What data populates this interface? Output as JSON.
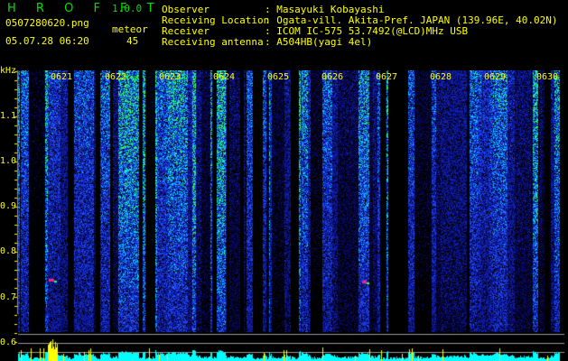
{
  "app": {
    "name": "H R O F F T",
    "version": "1.0.0"
  },
  "file": {
    "name": "0507280620.png",
    "datetime": "05.07.28 06:20"
  },
  "meteor": {
    "label": "meteor",
    "count": "45"
  },
  "station": {
    "observer_label": "Observer",
    "observer": ": Masayuki Kobayashi",
    "location_label": "Receiving Location",
    "location": ": Ogata-vill. Akita-Pref. JAPAN (139.96E, 40.02N)",
    "receiver_label": "Receiver",
    "receiver": ": ICOM IC-575 53.7492(@LCD)MHz USB",
    "antenna_label": "Receiving antenna",
    "antenna": ": A504HB(yagi 4el)"
  },
  "axis": {
    "unit": "kHz",
    "y_ticks": [
      "1.1",
      "1.0",
      "0.9",
      "0.8",
      "0.7",
      "0.6"
    ],
    "x_ticks": [
      "0621",
      "0622",
      "0623",
      "0624",
      "0625",
      "0626",
      "0627",
      "0628",
      "0629",
      "0630"
    ]
  },
  "colors": {
    "text": "#ffff00",
    "logo": "#00e000",
    "histogram": "#00ffff",
    "spike": "#ffff00"
  }
}
